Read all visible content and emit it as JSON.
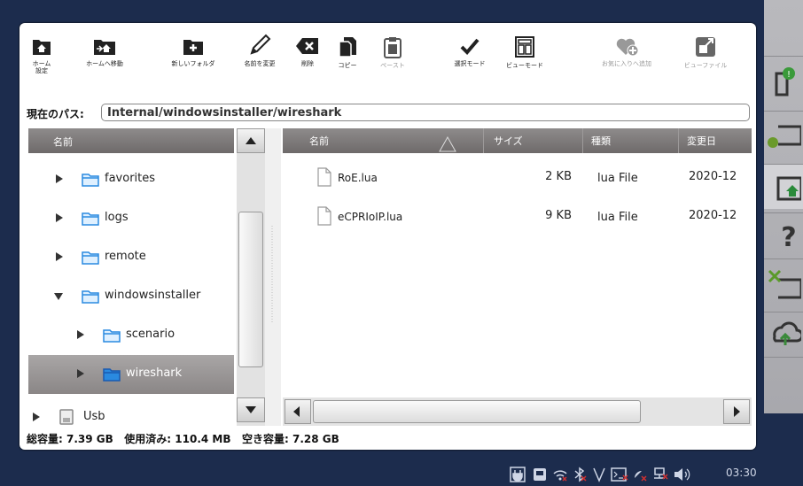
{
  "toolbar": {
    "items": [
      {
        "label": "ホーム\n設定",
        "icon": "home-settings-icon"
      },
      {
        "label": "ホームへ移動",
        "icon": "go-home-icon"
      },
      {
        "label": "新しいフォルダ",
        "icon": "new-folder-icon"
      },
      {
        "label": "名前を変更",
        "icon": "rename-icon"
      },
      {
        "label": "削除",
        "icon": "delete-icon"
      },
      {
        "label": "コピー",
        "icon": "copy-icon"
      },
      {
        "label": "ペースト",
        "icon": "paste-icon",
        "disabled": true
      },
      {
        "label": "選択モード",
        "icon": "select-mode-icon"
      },
      {
        "label": "ビューモード",
        "icon": "view-mode-icon"
      },
      {
        "label": "お気に入りへ追加",
        "icon": "add-favorite-icon",
        "disabled": true
      },
      {
        "label": "ビューファイル",
        "icon": "view-file-icon",
        "disabled": true
      }
    ]
  },
  "path": {
    "label": "現在のパス:",
    "value": "Internal/windowsinstaller/wireshark"
  },
  "tree": {
    "header": "名前",
    "items": [
      {
        "name": "favorites",
        "expanded": false,
        "indent": 0
      },
      {
        "name": "logs",
        "expanded": false,
        "indent": 0
      },
      {
        "name": "remote",
        "expanded": false,
        "indent": 0
      },
      {
        "name": "windowsinstaller",
        "expanded": true,
        "indent": 0
      },
      {
        "name": "scenario",
        "expanded": false,
        "indent": 1
      },
      {
        "name": "wireshark",
        "expanded": false,
        "indent": 1,
        "selected": true
      },
      {
        "name": "Usb",
        "expanded": false,
        "indent": -1,
        "drive": true
      }
    ]
  },
  "files": {
    "columns": [
      "名前",
      "サイズ",
      "種類",
      "変更日"
    ],
    "rows": [
      {
        "name": "RoE.lua",
        "size": "2 KB",
        "type": "lua File",
        "date": "2020-12"
      },
      {
        "name": "eCPRIoIP.lua",
        "size": "9 KB",
        "type": "lua File",
        "date": "2020-12"
      }
    ]
  },
  "status": {
    "text": "総容量: 7.39 GB   使用済み: 110.4 MB   空き容量: 7.28 GB"
  },
  "taskbar": {
    "clock": "03:30"
  },
  "side_panel": {
    "icons": [
      "folder-info-icon",
      "folder-settings-icon",
      "folder-home-icon",
      "help-icon",
      "folder-tools-icon",
      "cloud-upload-icon"
    ]
  },
  "colors": {
    "background": "#1c2c4d",
    "header": "#7e7a7a",
    "selected": "#9a9696",
    "folder": "#2a8ae0"
  }
}
